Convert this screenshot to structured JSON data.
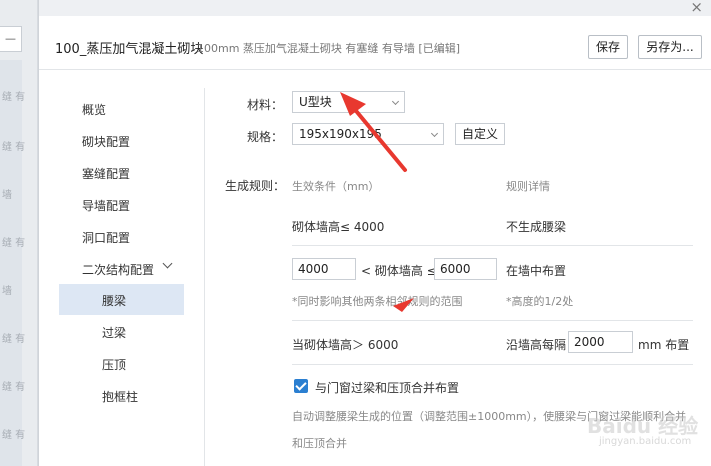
{
  "backdrop": {
    "top_button": "—",
    "labels": [
      "缝 有",
      "缝 有",
      "墙",
      "缝 有",
      "墙",
      "缝 有",
      "缝 有",
      "缝 有"
    ]
  },
  "window": {
    "close": "×"
  },
  "header": {
    "title": "100_蒸压加气混凝土砌块",
    "subtitle": "100mm 蒸压加气混凝土砌块 有塞缝 有导墙 [已编辑]",
    "save_label": "保存",
    "saveas_label": "另存为..."
  },
  "sidebar": {
    "items": [
      {
        "label": "概览"
      },
      {
        "label": "砌块配置"
      },
      {
        "label": "塞缝配置"
      },
      {
        "label": "导墙配置"
      },
      {
        "label": "洞口配置"
      },
      {
        "label": "二次结构配置"
      }
    ],
    "subitems": [
      {
        "label": "腰梁",
        "active": true
      },
      {
        "label": "过梁"
      },
      {
        "label": "压顶"
      },
      {
        "label": "抱框柱"
      }
    ]
  },
  "form": {
    "material_label": "材料：",
    "material_value": "U型块",
    "spec_label": "规格：",
    "spec_value": "195x190x195",
    "custom_label": "自定义",
    "rules_label": "生成规则：",
    "col_condition": "生效条件（mm）",
    "col_detail": "规则详情",
    "rule1_condition": "砌体墙高≤ 4000",
    "rule1_detail": "不生成腰梁",
    "rule2_min": "4000",
    "rule2_mid": "< 砌体墙高 ≤",
    "rule2_max": "6000",
    "rule2_detail": "在墙中布置",
    "rule2_note": "*同时影响其他两条相邻规则的范围",
    "rule2_note_right": "*高度的1/2处",
    "rule3_condition": "当砌体墙高＞ 6000",
    "rule3_detail_pre": "沿墙高每隔",
    "rule3_value": "2000",
    "rule3_detail_post": "mm 布置",
    "merge_label": "与门窗过梁和压顶合并布置",
    "merge_desc_1": "自动调整腰梁生成的位置（调整范围±1000mm），使腰梁与门窗过梁能顺利合并",
    "merge_desc_2": "和压顶合并"
  },
  "watermark": {
    "brand": "Baidu 经验",
    "url": "jingyan.baidu.com"
  },
  "colors": {
    "accent": "#2b7fd1",
    "active_bg": "#dde7f4",
    "annotation": "#e8382f"
  }
}
